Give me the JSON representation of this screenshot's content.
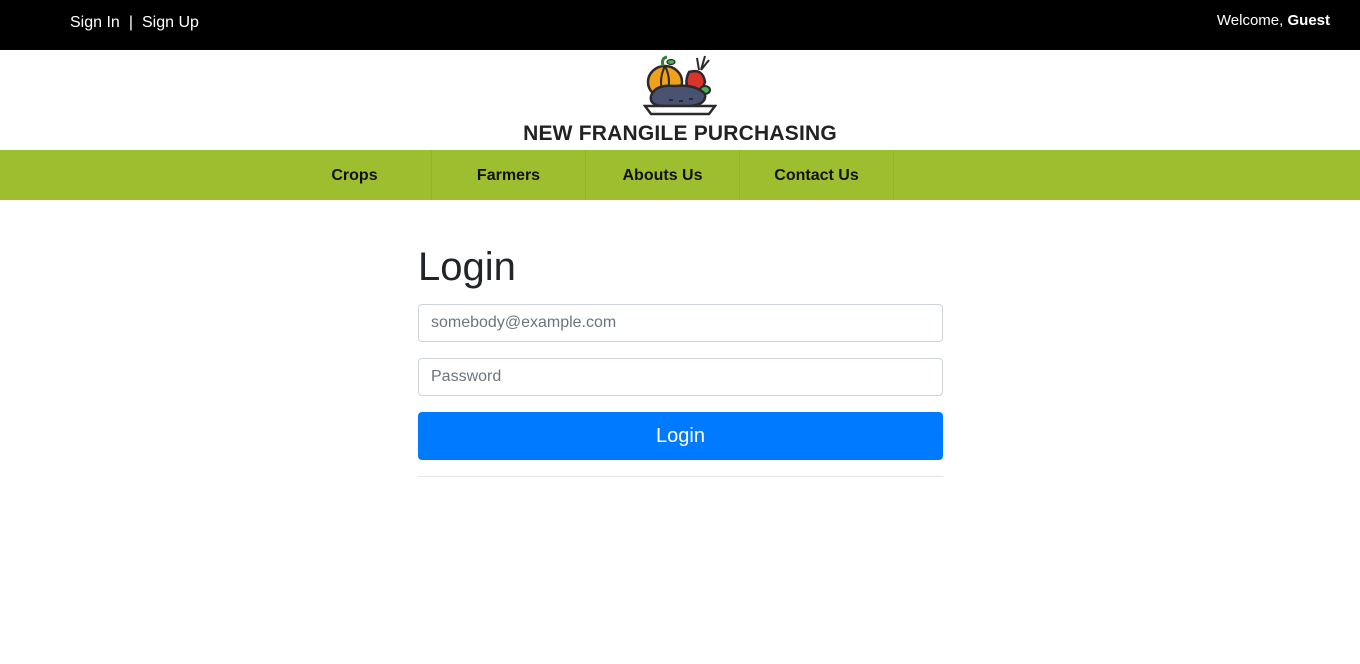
{
  "topbar": {
    "sign_in": "Sign In",
    "separator": "|",
    "sign_up": "Sign Up",
    "welcome_prefix": "Welcome,",
    "welcome_user": "Guest"
  },
  "brand": {
    "logo_icon": "vegetable-basket-icon",
    "title": "NEW FRANGILE PURCHASING"
  },
  "nav": {
    "items": [
      {
        "label": "Crops"
      },
      {
        "label": "Farmers"
      },
      {
        "label": "Abouts Us"
      },
      {
        "label": "Contact Us"
      }
    ],
    "bar_color": "#9cbe2f"
  },
  "login": {
    "heading": "Login",
    "email_placeholder": "somebody@example.com",
    "email_value": "",
    "password_placeholder": "Password",
    "password_value": "",
    "submit_label": "Login",
    "button_color": "#007bff"
  }
}
